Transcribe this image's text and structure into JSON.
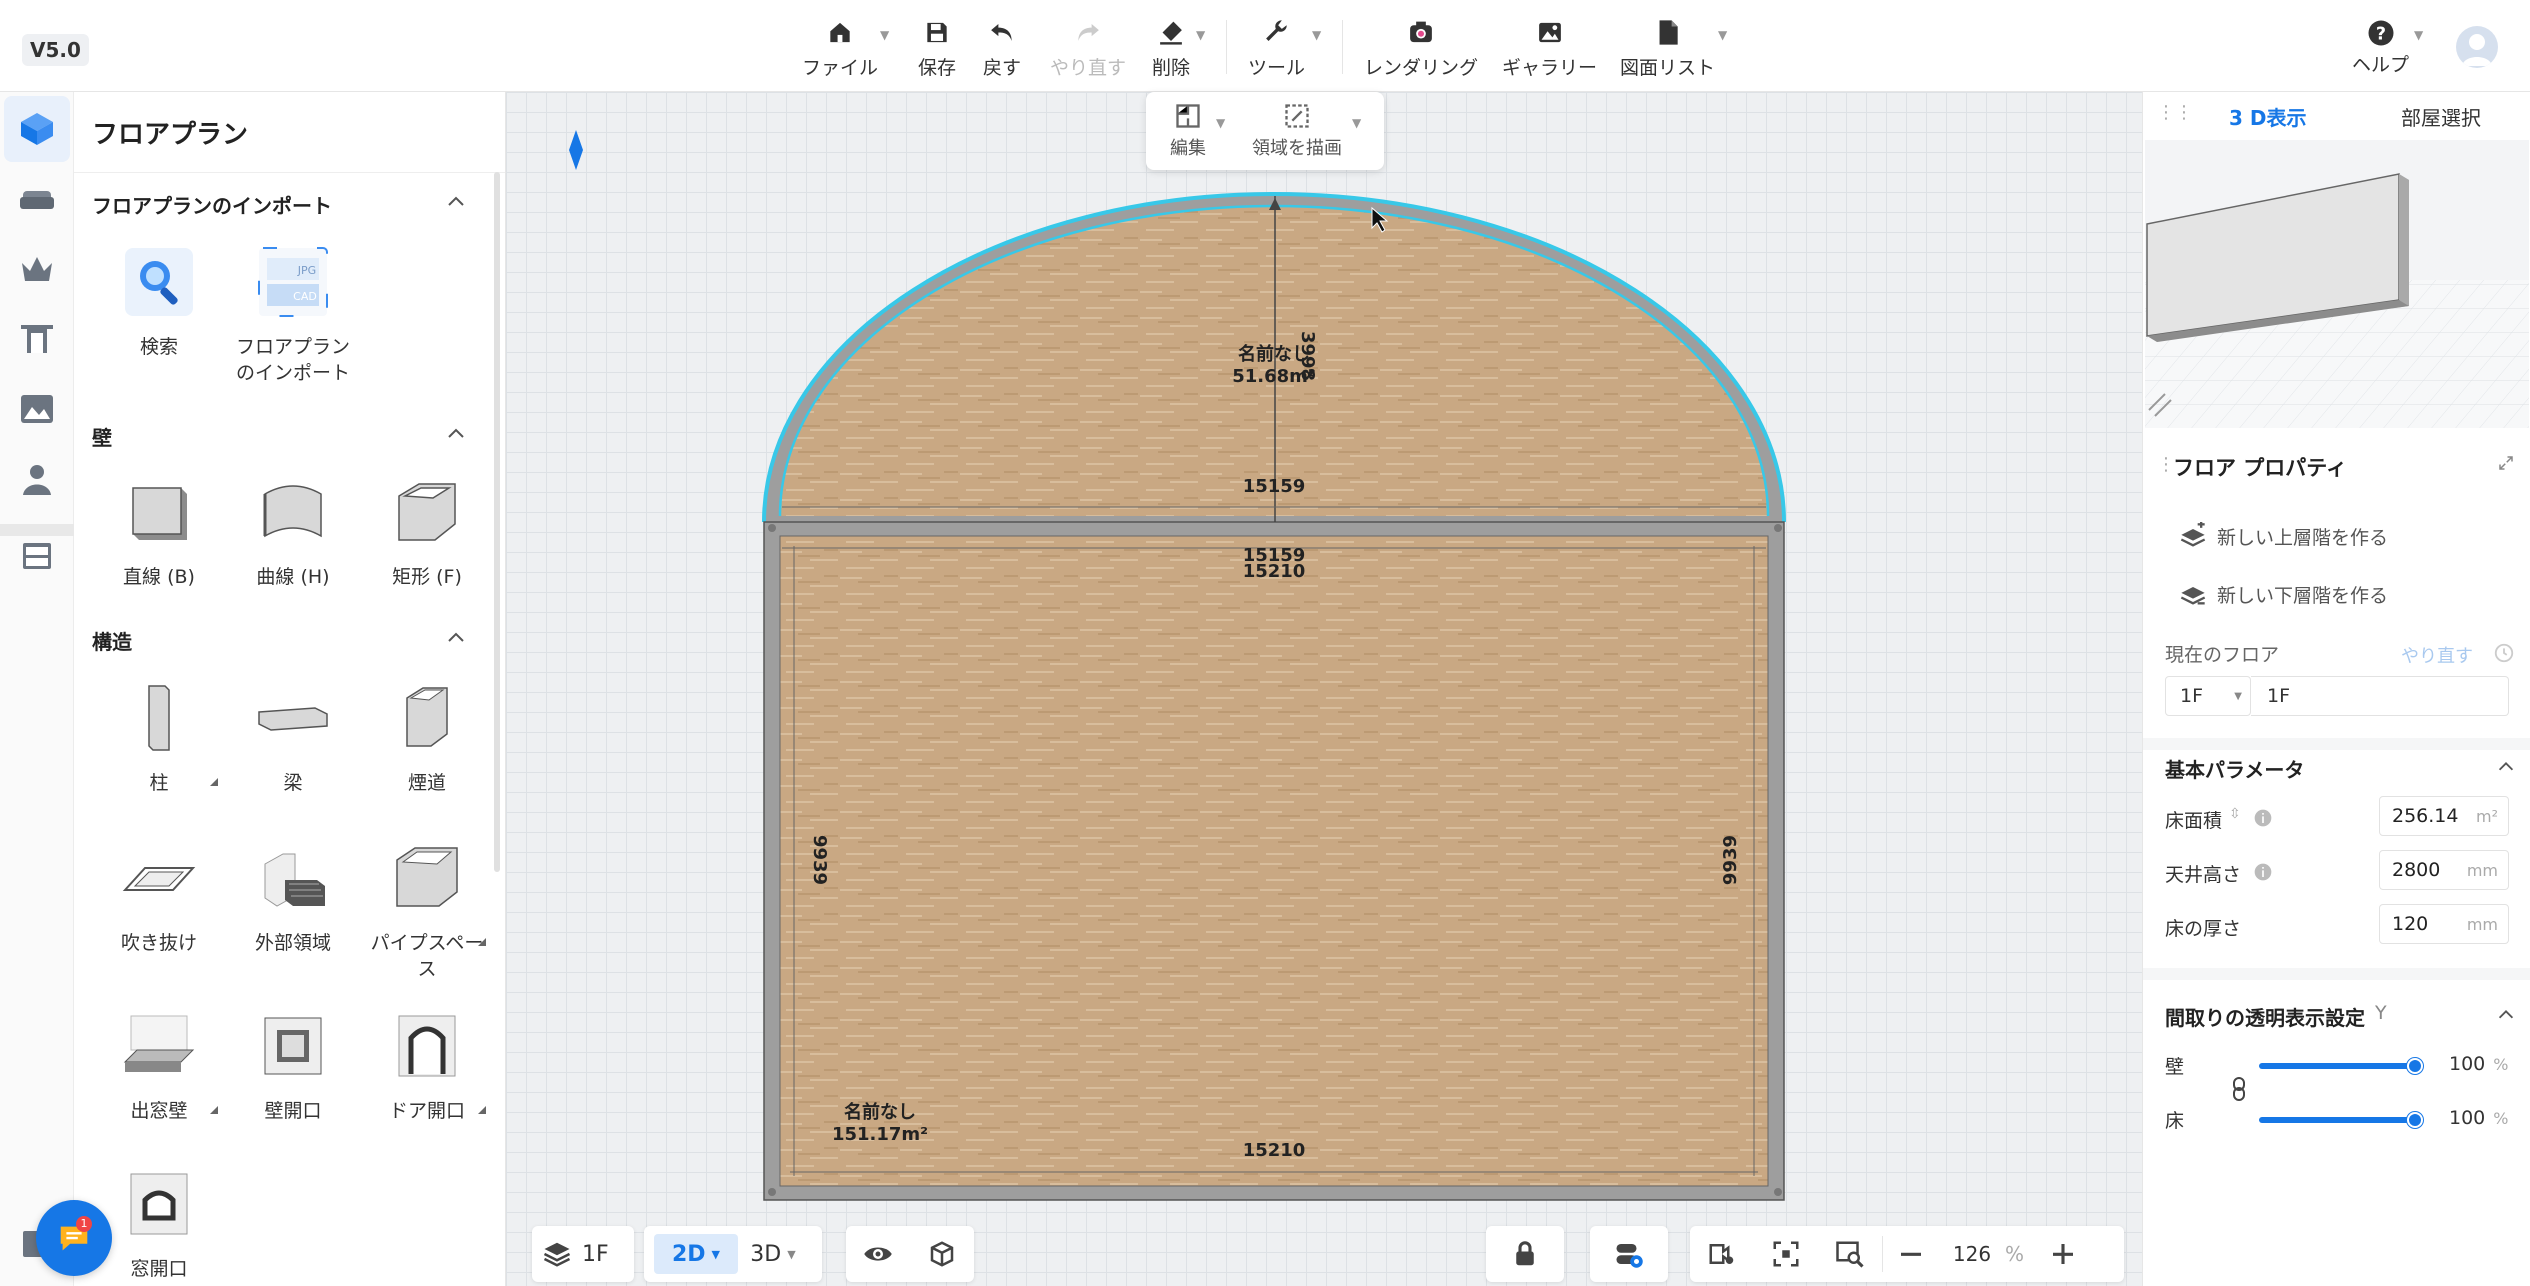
{
  "version": "V5.0",
  "toolbar": {
    "file": "ファイル",
    "save": "保存",
    "undo": "戻す",
    "redo": "やり直す",
    "delete": "削除",
    "tools": "ツール",
    "rendering": "レンダリング",
    "gallery": "ギャラリー",
    "drawings": "図面リスト",
    "help": "ヘルプ"
  },
  "rail": {
    "items": [
      "floorplan-icon",
      "sofa-icon",
      "crown-icon",
      "door-icon",
      "landscape-icon",
      "person-icon",
      "cabinet-icon",
      "document-icon"
    ]
  },
  "library": {
    "title": "フロアプラン",
    "sections": {
      "import": {
        "title": "フロアプランのインポート",
        "items": [
          "検索",
          "フロアプラン\nのインポート"
        ],
        "jpg": "JPG",
        "cad": "CAD"
      },
      "wall": {
        "title": "壁",
        "items": [
          "直線 (B)",
          "曲線 (H)",
          "矩形 (F)"
        ]
      },
      "structure": {
        "title": "構造",
        "items": [
          "柱",
          "梁",
          "煙道",
          "吹き抜け",
          "外部領域",
          "パイプスペース",
          "出窓壁",
          "壁開口",
          "ドア開口",
          "窓開口"
        ]
      }
    },
    "chat_badge": "1"
  },
  "canvas": {
    "edit": "編集",
    "draw_area": "領域を描画",
    "dims": {
      "arc_width": "15159",
      "arc_height": "3998",
      "top_inner": "15159",
      "top_outer": "15210",
      "bottom": "15210",
      "left": "9939",
      "right": "9939"
    },
    "rooms": [
      {
        "name": "名前なし",
        "area": "51.68m²"
      },
      {
        "name": "名前なし",
        "area": "151.17m²"
      }
    ]
  },
  "bottombar": {
    "floor": "1F",
    "mode2d": "2D",
    "mode3d": "3D",
    "zoom": "126",
    "zoom_unit": "%"
  },
  "right": {
    "tab_3d": "3 D表示",
    "tab_room": "部屋選択",
    "props_title": "フロア プロパティ",
    "new_upper": "新しい上層階を作る",
    "new_lower": "新しい下層階を作る",
    "current_floor_label": "現在のフロア",
    "redo": "やり直す",
    "floor_select": "1F",
    "floor_name": "1F",
    "basic_title": "基本パラメータ",
    "area_label": "床面積",
    "area_value": "256.14",
    "area_unit": "m²",
    "ceiling_label": "天井高さ",
    "ceiling_value": "2800",
    "ceiling_unit": "mm",
    "floor_thick_label": "床の厚さ",
    "floor_thick_value": "120",
    "floor_thick_unit": "mm",
    "transparency_title": "間取りの透明表示設定",
    "transparency_key": "Y",
    "wall_label": "壁",
    "wall_value": "100",
    "floor_label": "床",
    "floor_value": "100",
    "pct": "%"
  },
  "colors": {
    "accent": "#1677e6",
    "wood": "#c9a57f",
    "wall": "#a8a8a8",
    "selection": "#38c8e8"
  }
}
